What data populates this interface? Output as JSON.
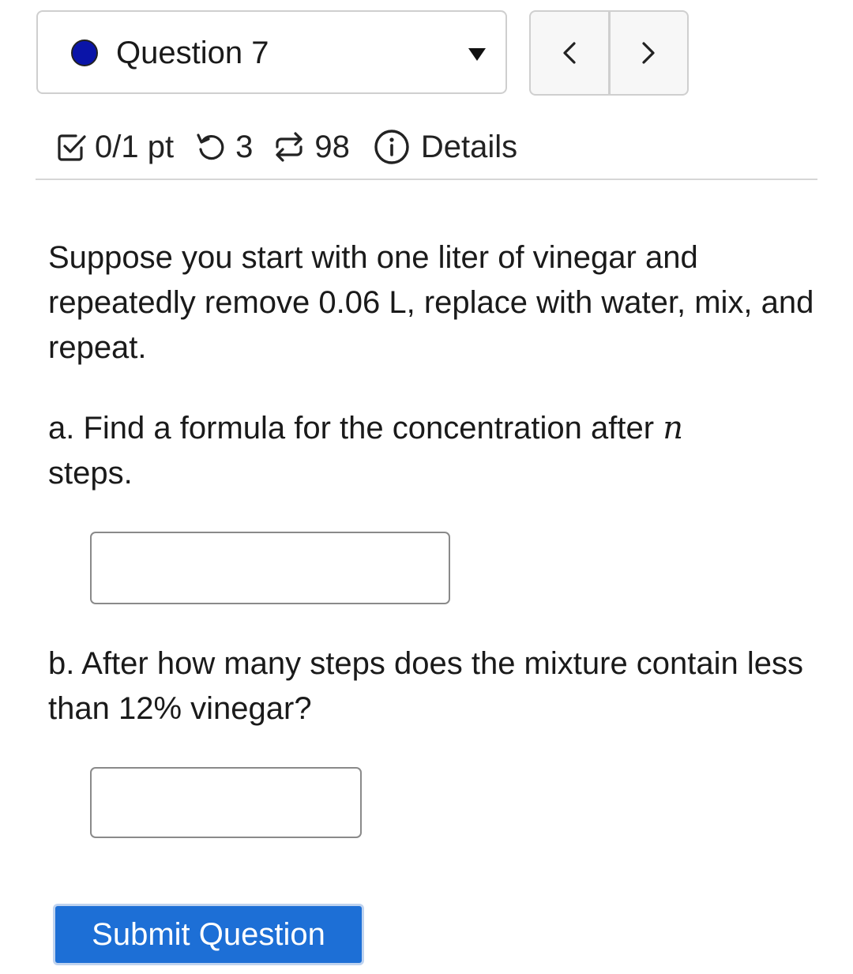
{
  "question_selector": {
    "label": "Question 7",
    "status_color": "#0a14a8"
  },
  "nav": {
    "prev_icon": "chevron-left-icon",
    "next_icon": "chevron-right-icon"
  },
  "info": {
    "points": "0/1 pt",
    "retries": "3",
    "attempts": "98",
    "details_label": "Details"
  },
  "question": {
    "intro": "Suppose you start with one liter of vinegar and repeatedly remove 0.06 L, replace with water, mix, and repeat.",
    "part_a_prefix": "a. Find a formula for the concentration after",
    "part_a_var": "n",
    "part_a_suffix": "steps.",
    "part_b": "b. After how many steps does the mixture contain less than 12% vinegar?"
  },
  "answers": {
    "a_value": "",
    "b_value": ""
  },
  "submit_label": "Submit Question",
  "colors": {
    "submit_bg": "#1d6fd6",
    "border": "#cfcfcf"
  }
}
